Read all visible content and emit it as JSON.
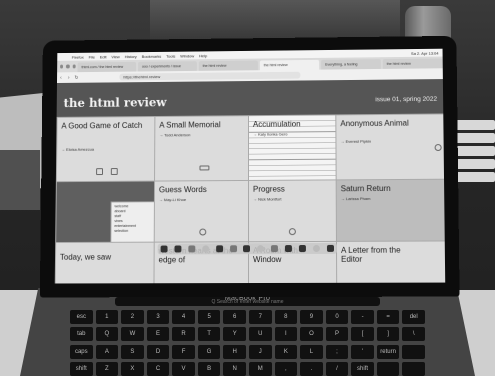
{
  "browser": {
    "menubar": [
      "Firefox",
      "File",
      "Edit",
      "View",
      "History",
      "Bookmarks",
      "Tools",
      "Window",
      "Help"
    ],
    "menubar_right": "Sa 2. Apr 13:04",
    "tabs": [
      "thtml.com / the html review",
      "ooo / experiments / issue",
      "the html review",
      "the html review",
      "Everything, a feeling",
      "the html review"
    ],
    "url": "https://thehtml.review"
  },
  "site": {
    "title": "the html review",
    "issue": "issue 01, spring 2022"
  },
  "entries": [
    {
      "title": "A Good Game of Catch",
      "author": "→ Eloisa Amezcua"
    },
    {
      "title": "A Small Memorial",
      "author": "→ Todd Anderson"
    },
    {
      "title": "Accumulation",
      "author": "→ Katy Ilonka Gero"
    },
    {
      "title": "Anonymous Animal",
      "author": "→ Everest Pipkin"
    },
    {
      "title": "Guess Words",
      "author": "→ May-Li Khoe"
    },
    {
      "title": "Progress",
      "author": "→ Nick Montfort"
    },
    {
      "title": "Saturn Return",
      "author": "→ Larissa Pham"
    },
    {
      "title": "Today, we saw",
      "author": ""
    },
    {
      "title": "western hearts at the edge of",
      "author": ""
    },
    {
      "title": "A Room with a Window",
      "author": ""
    },
    {
      "title": "A Letter from the Editor",
      "author": ""
    }
  ],
  "menu_box": [
    "welcome",
    "aboard",
    "staff",
    "vines",
    "entertainment",
    "selection"
  ],
  "laptop": {
    "model": "MacBook Pro",
    "touchbar": "Q Search or enter website name"
  },
  "keyboard": [
    "esc",
    "1",
    "2",
    "3",
    "4",
    "5",
    "6",
    "7",
    "8",
    "9",
    "0",
    "-",
    "=",
    "del",
    "tab",
    "Q",
    "W",
    "E",
    "R",
    "T",
    "Y",
    "U",
    "I",
    "O",
    "P",
    "[",
    "]",
    "\\",
    "caps",
    "A",
    "S",
    "D",
    "F",
    "G",
    "H",
    "J",
    "K",
    "L",
    ";",
    "'",
    "return",
    "",
    "shift",
    "Z",
    "X",
    "C",
    "V",
    "B",
    "N",
    "M",
    ",",
    ".",
    "/",
    "shift",
    "",
    ""
  ]
}
